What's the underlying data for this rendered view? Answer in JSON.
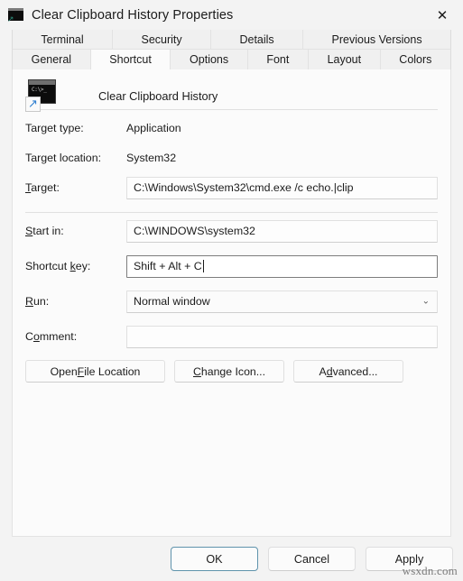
{
  "window": {
    "title": "Clear Clipboard History Properties",
    "icon": "cmd-shortcut-icon",
    "close_label": "✕"
  },
  "tabs": {
    "row1": [
      {
        "label": "Terminal",
        "active": false
      },
      {
        "label": "Security",
        "active": false
      },
      {
        "label": "Details",
        "active": false
      },
      {
        "label": "Previous Versions",
        "active": false
      }
    ],
    "row2": [
      {
        "label": "General",
        "active": false
      },
      {
        "label": "Shortcut",
        "active": true
      },
      {
        "label": "Options",
        "active": false
      },
      {
        "label": "Font",
        "active": false
      },
      {
        "label": "Layout",
        "active": false
      },
      {
        "label": "Colors",
        "active": false
      }
    ]
  },
  "shortcut": {
    "name": "Clear Clipboard History",
    "fields": {
      "target_type_label": "Target type:",
      "target_type_value": "Application",
      "target_location_label": "Target location:",
      "target_location_value": "System32",
      "target_label_pre": "",
      "target_label_accel": "T",
      "target_label_post": "arget:",
      "target_value": "C:\\Windows\\System32\\cmd.exe /c echo.|clip",
      "start_in_label_pre": "",
      "start_in_label_accel": "S",
      "start_in_label_post": "tart in:",
      "start_in_value": "C:\\WINDOWS\\system32",
      "shortcut_key_label_pre": "Shortcut ",
      "shortcut_key_label_accel": "k",
      "shortcut_key_label_post": "ey:",
      "shortcut_key_value": "Shift + Alt + C",
      "run_label_pre": "",
      "run_label_accel": "R",
      "run_label_post": "un:",
      "run_value": "Normal window",
      "run_chevron": "⌄",
      "comment_label_pre": "C",
      "comment_label_accel": "o",
      "comment_label_post": "mment:",
      "comment_value": "",
      "comment_placeholder": ""
    },
    "buttons": [
      {
        "pre": "Open ",
        "accel": "F",
        "post": "ile Location",
        "name": "open-file-location-button"
      },
      {
        "pre": "",
        "accel": "C",
        "post": "hange Icon...",
        "name": "change-icon-button"
      },
      {
        "pre": "A",
        "accel": "d",
        "post": "vanced...",
        "name": "advanced-button"
      }
    ]
  },
  "footer": {
    "ok": "OK",
    "cancel": "Cancel",
    "apply": "Apply"
  },
  "watermark": "wsxdn.com",
  "colors": {
    "window_bg": "#f3f3f3",
    "panel_bg": "#fbfbfb",
    "text": "#1b1b1b",
    "default_button_border": "#5f93ac",
    "shortcut_arrow": "#2f7fd0"
  }
}
